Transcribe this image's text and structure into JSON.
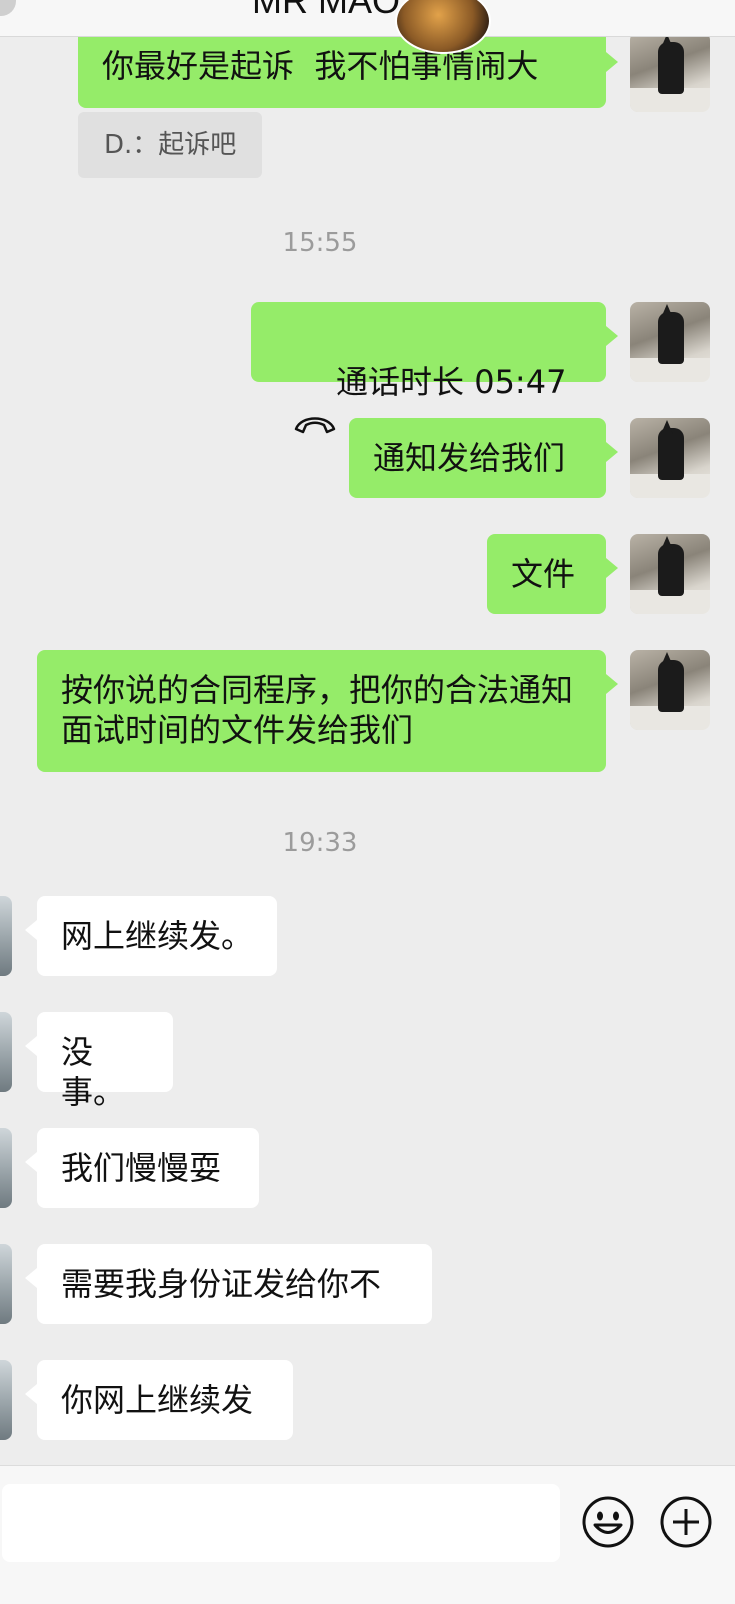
{
  "header": {
    "title": "MR MAO",
    "avatar_icon": "contact-avatar-icon",
    "back_icon": "back-icon"
  },
  "quote": {
    "text": "D.：起诉吧"
  },
  "messages": [
    {
      "side": "sent",
      "text": "你最好是起诉  我不怕事情闹大"
    },
    {
      "kind": "timestamp",
      "text": "15:55"
    },
    {
      "side": "sent",
      "type": "call",
      "text": "通话时长 05:47",
      "icon": "phone-hangup-icon"
    },
    {
      "side": "sent",
      "text": "通知发给我们"
    },
    {
      "side": "sent",
      "text": "文件"
    },
    {
      "side": "sent",
      "text": "按你说的合同程序，把你的合法通知面试时间的文件发给我们"
    },
    {
      "kind": "timestamp",
      "text": "19:33"
    },
    {
      "side": "recv",
      "text": "网上继续发。"
    },
    {
      "side": "recv",
      "text": "没事。"
    },
    {
      "side": "recv",
      "text": "我们慢慢耍"
    },
    {
      "side": "recv",
      "text": "需要我身份证发给你不"
    },
    {
      "side": "recv",
      "text": "你网上继续发"
    }
  ],
  "input_bar": {
    "value": "",
    "emoji_icon": "emoji-icon",
    "add_icon": "plus-circle-icon"
  },
  "colors": {
    "sent_bubble": "#95ec69",
    "recv_bubble": "#ffffff",
    "background": "#ededed"
  }
}
